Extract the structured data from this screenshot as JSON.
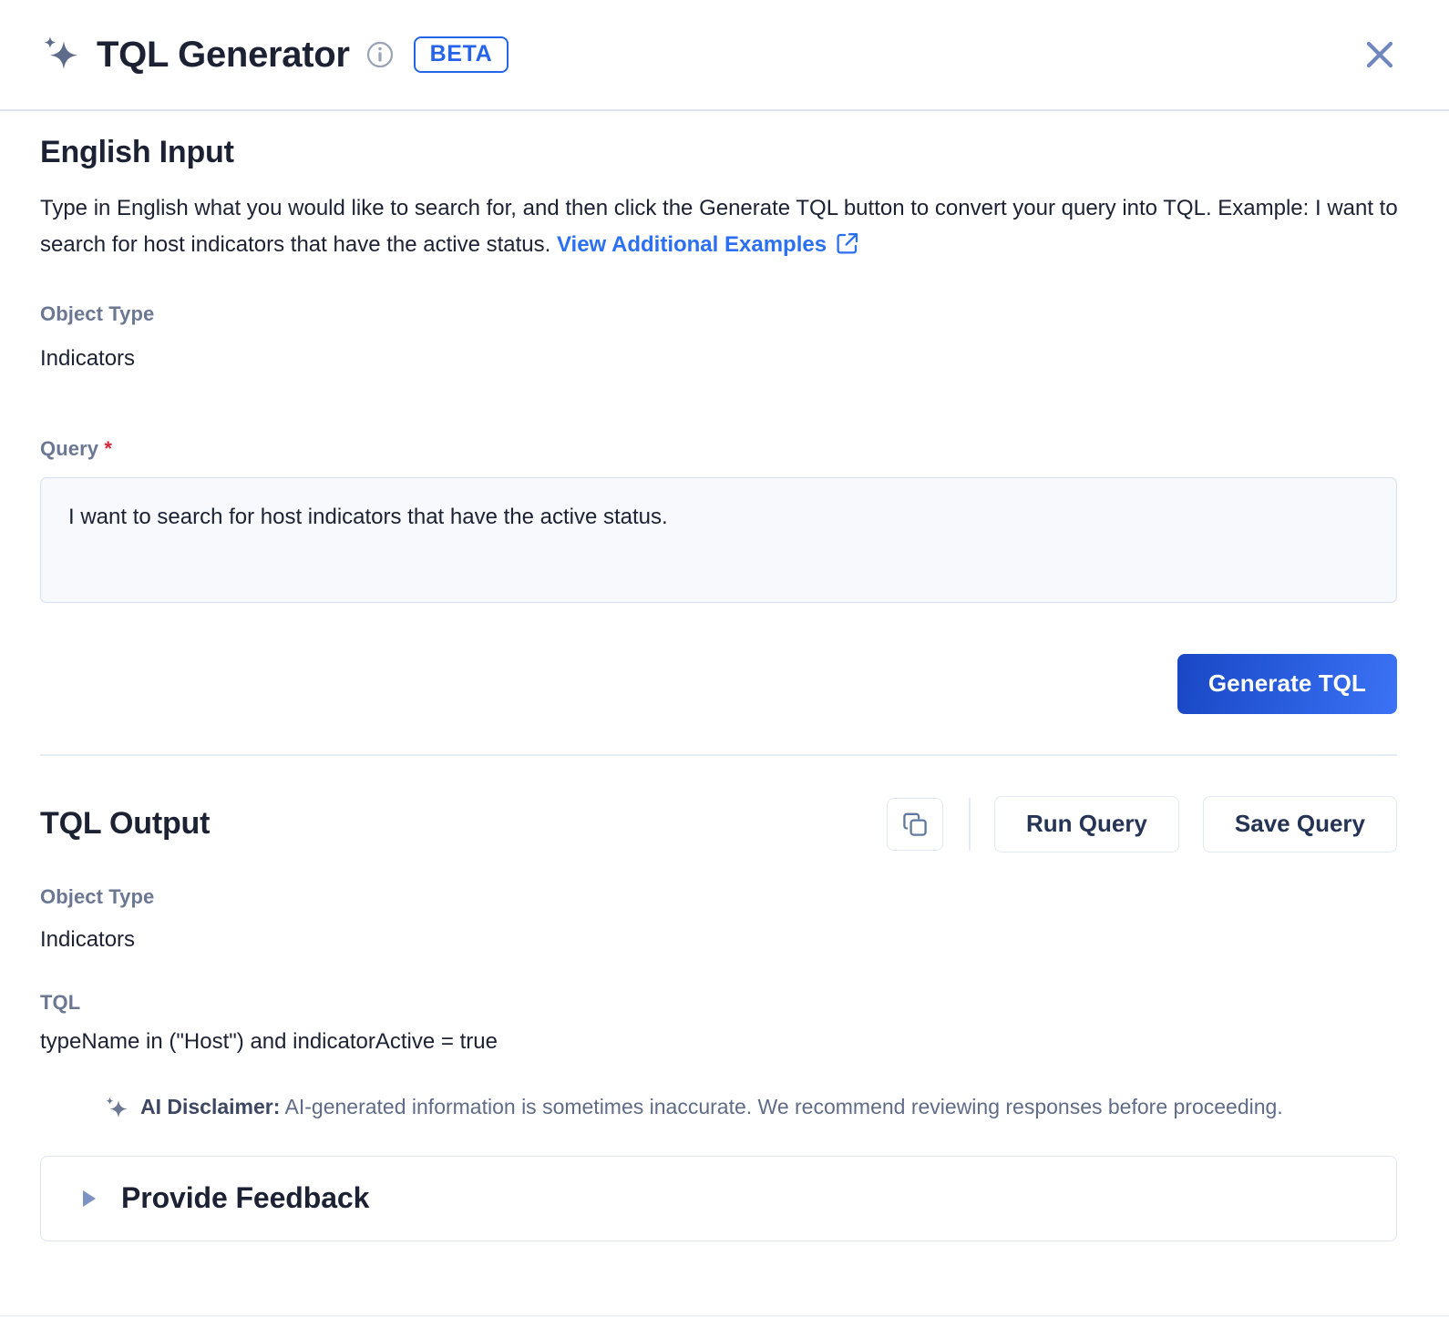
{
  "header": {
    "title": "TQL Generator",
    "badge": "BETA",
    "sparkle_icon": "sparkle-icon",
    "info_icon": "info-circle-icon",
    "close_icon": "close-icon"
  },
  "english_input": {
    "section_title": "English Input",
    "description_part1": "Type in English what you would like to search for, and then click the Generate TQL button to convert your query into TQL. Example: I want to search for host indicators that have the active status. ",
    "link_label": "View Additional Examples",
    "link_icon": "external-link-icon",
    "object_type_label": "Object Type",
    "object_type_value": "Indicators",
    "query_label": "Query",
    "query_required_marker": "*",
    "query_value": "I want to search for host indicators that have the active status.",
    "query_placeholder": "I want to search for host indicators that have the active status.",
    "generate_button": "Generate TQL"
  },
  "tql_output": {
    "section_title": "TQL Output",
    "copy_icon": "copy-icon",
    "run_query_button": "Run Query",
    "save_query_button": "Save Query",
    "object_type_label": "Object Type",
    "object_type_value": "Indicators",
    "tql_label": "TQL",
    "tql_value": "typeName in (\"Host\") and indicatorActive = true",
    "disclaimer_icon": "sparkle-icon",
    "disclaimer_bold": "AI Disclaimer:",
    "disclaimer_text": " AI-generated information is sometimes inaccurate. We recommend reviewing responses before proceeding."
  },
  "feedback": {
    "label": "Provide Feedback",
    "caret_icon": "caret-right-icon"
  },
  "colors": {
    "accent_blue": "#2563eb",
    "button_gradient_start": "#1a47c4",
    "button_gradient_end": "#3c72f5",
    "label_gray": "#6b7793",
    "text_dark": "#1c2133",
    "required_red": "#d72638"
  }
}
